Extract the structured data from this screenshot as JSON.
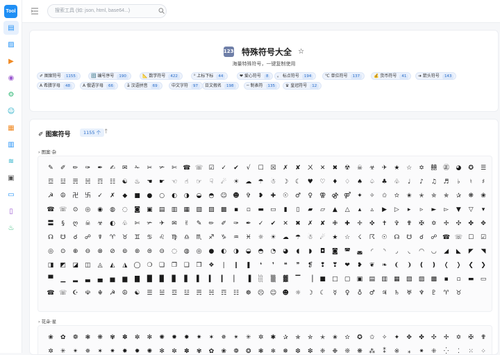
{
  "app": {
    "logo_text": "Tool"
  },
  "sidebar": {
    "items": [
      {
        "icon": "document-icon",
        "active": true
      },
      {
        "icon": "image-icon"
      },
      {
        "icon": "video-icon"
      },
      {
        "icon": "color-icon"
      },
      {
        "icon": "gear-icon"
      },
      {
        "icon": "user-icon"
      },
      {
        "icon": "grid-icon"
      },
      {
        "icon": "chart-icon"
      },
      {
        "icon": "wifi-icon"
      },
      {
        "icon": "printer-icon"
      },
      {
        "icon": "terminal-icon"
      },
      {
        "icon": "book-icon"
      },
      {
        "icon": "cup-icon"
      }
    ]
  },
  "topbar": {
    "search_placeholder": "搜索工具 (如: json, html, base64...)"
  },
  "header": {
    "title_icon": "1234",
    "title": "特殊符号大全",
    "subtitle": "海量特殊符号，一键复制使用"
  },
  "tags": [
    {
      "label": "✐ 图案符号",
      "count": "1155"
    },
    {
      "label": "🔢 编号序号",
      "count": "190"
    },
    {
      "label": "📐 数学符号",
      "count": "422"
    },
    {
      "label": "⁰ 上标下标",
      "count": "44"
    },
    {
      "label": "❤ 爱心符号",
      "count": "8"
    },
    {
      "label": "。 标点符号",
      "count": "194"
    },
    {
      "label": "℃ 单位符号",
      "count": "137"
    },
    {
      "label": "💰 货币符号",
      "count": "41"
    },
    {
      "label": "➜ 箭头符号",
      "count": "143"
    },
    {
      "label": "Α 希腊字母",
      "count": "48"
    },
    {
      "label": "А 俄语字母",
      "count": "66"
    },
    {
      "label": "ā 汉语拼音",
      "count": "69"
    },
    {
      "label": "中文字符",
      "count": "97"
    },
    {
      "label": "日文假名",
      "count": "198"
    },
    {
      "label": "─ 制表符",
      "count": "135"
    },
    {
      "label": "♛ 皇冠符号",
      "count": "12"
    }
  ],
  "section": {
    "title": "✐ 图案符号",
    "count": "1155 个"
  },
  "group1": {
    "title": "› 图案·杂",
    "rows": [
      "✎✐✏✑✒✍✉✁✂✃✄☎☏☑✓✔√☐☒✗✘ㄨ✕✖☢☠☣✈★☆✡囍㊣◕✪☰☱",
      "☲☳☴☵☶☷☯♨☚☛☜☝☞☟☄☀☁☂☃☽☾♥♡♦♢♠♤♣♧♩♪♫♬♭♮♯°ø☪❂☸❣",
      "☭☮卍卐✓✗◆■●○◐◑◒◓☺☻✞❥✚☉♂♀⚢⚣⚤✦✧✩✫✬✭✮✯✰❋❀✿❁✾❃❅❄",
      "☎☏⊙◎◉◍◌◙▣▤▥▦▧▨▩▪▫▬▭▮▯▰▱▲△▴▵▶▷▸▹►▻▼▽▾▿◀◁◂",
      "〓§ღ☠☣◐♧✄✃✈✉✌✎✏✐✑✒✓✔✕✖✗✘✙✚✛✜✝✞✟✠✡✢✣✤✥✦✧✩✪",
      "☊☋☌☍☤♈♉♊♋♌♍♎♏♐♑♒♓☼☀☁☂☃☄★☆☇☈☉☊☋☌☍☎☏☐☑☒☓",
      "◎⊙⊕⊖⊗⊘⊚⊛⊜⊝◌◍◎●◐◑◒◓◔◕◖◗◘◙◚◛◜◝◞◟◠◡◢◣◤◥◦◧",
      "◨◩◪◫◬◭◮◯❍❏❐❑❒❖❘❙❚❛❜❝❞❡❢❣❤❥❦❧❨❩❪❫❬❭❮❯❰❱❲❳",
      "▀▁▂▃▄▅▆▇█▉▊▋▌▍▎▏▐░▒▓▔▕■□▢▣▤▥▦▧▨▩▪▫▬▭▮▯▰▱",
      "☎☏☪☫☬☭☮☯☰☱☲☳☴☵☶☷☸☹☺☻☼☽☾☿♀♁♂♃♄♅♆♇♈♉"
    ]
  },
  "group2": {
    "title": "› 花朵·星",
    "rows": [
      "❀✿❁❃❋✾✽✼✻✺✹✸✷✶✵✴✳✲✱✰✯✮✭✬✫✪✩✧✦✥✤✣✢✡✠✟✞",
      "✲✳✴✵✶✷✸✹✺✻✼✽✾✿❀❁❂❃❄❅❆❇❈❉❊❋⁂⁑※⁎⁕⁜⁛⁚⁙⁘⁖⁗⁞",
      ";?',\"\"′″‵‶‷‹›«»¡¿‽⁇⁈⁉‼‧‥…—–―‖‗''\"\"‚„‟†‡•‣"
    ]
  }
}
